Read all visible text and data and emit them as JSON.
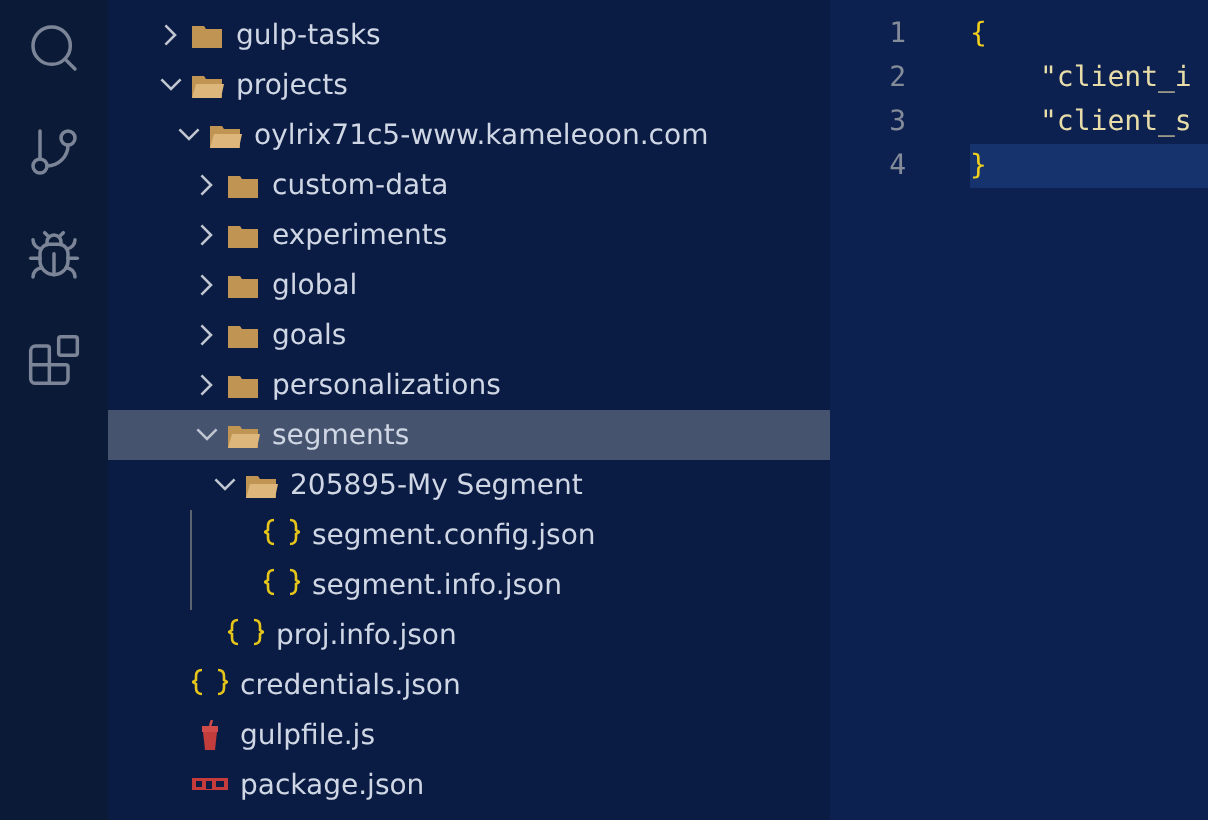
{
  "activity_bar": {
    "items": [
      {
        "kind": "search",
        "selected": false
      },
      {
        "kind": "source-control",
        "selected": false
      },
      {
        "kind": "debug",
        "selected": false
      },
      {
        "kind": "extensions",
        "selected": false
      }
    ]
  },
  "explorer": {
    "tree": [
      {
        "kind": "folder",
        "label": "gulp-tasks",
        "expanded": false,
        "selected": false
      },
      {
        "kind": "folder",
        "label": "projects",
        "expanded": true,
        "selected": false,
        "children": [
          {
            "kind": "folder",
            "label": "oylrix71c5-www.kameleoon.com",
            "expanded": true,
            "selected": false,
            "children": [
              {
                "kind": "folder",
                "label": "custom-data",
                "expanded": false,
                "selected": false
              },
              {
                "kind": "folder",
                "label": "experiments",
                "expanded": false,
                "selected": false
              },
              {
                "kind": "folder",
                "label": "global",
                "expanded": false,
                "selected": false
              },
              {
                "kind": "folder",
                "label": "goals",
                "expanded": false,
                "selected": false
              },
              {
                "kind": "folder",
                "label": "personalizations",
                "expanded": false,
                "selected": false
              },
              {
                "kind": "folder",
                "label": "segments",
                "expanded": true,
                "selected": true,
                "children": [
                  {
                    "kind": "folder",
                    "label": "205895-My Segment",
                    "expanded": true,
                    "selected": false,
                    "children": [
                      {
                        "kind": "json",
                        "label": "segment.config.json",
                        "selected": false
                      },
                      {
                        "kind": "json",
                        "label": "segment.info.json",
                        "selected": false
                      }
                    ]
                  }
                ]
              },
              {
                "kind": "json",
                "label": "proj.info.json",
                "selected": false
              }
            ]
          }
        ]
      },
      {
        "kind": "json",
        "label": "credentials.json",
        "selected": false
      },
      {
        "kind": "gulp",
        "label": "gulpfile.js",
        "selected": false
      },
      {
        "kind": "npm",
        "label": "package.json",
        "selected": false
      }
    ]
  },
  "editor": {
    "lines": [
      {
        "number": "1",
        "text": "{",
        "kind": "brace",
        "current": false
      },
      {
        "number": "2",
        "text": "\"client_i",
        "kind": "string",
        "current": false
      },
      {
        "number": "3",
        "text": "\"client_s",
        "kind": "string",
        "current": false
      },
      {
        "number": "4",
        "text": "}",
        "kind": "brace",
        "current": true
      }
    ]
  }
}
